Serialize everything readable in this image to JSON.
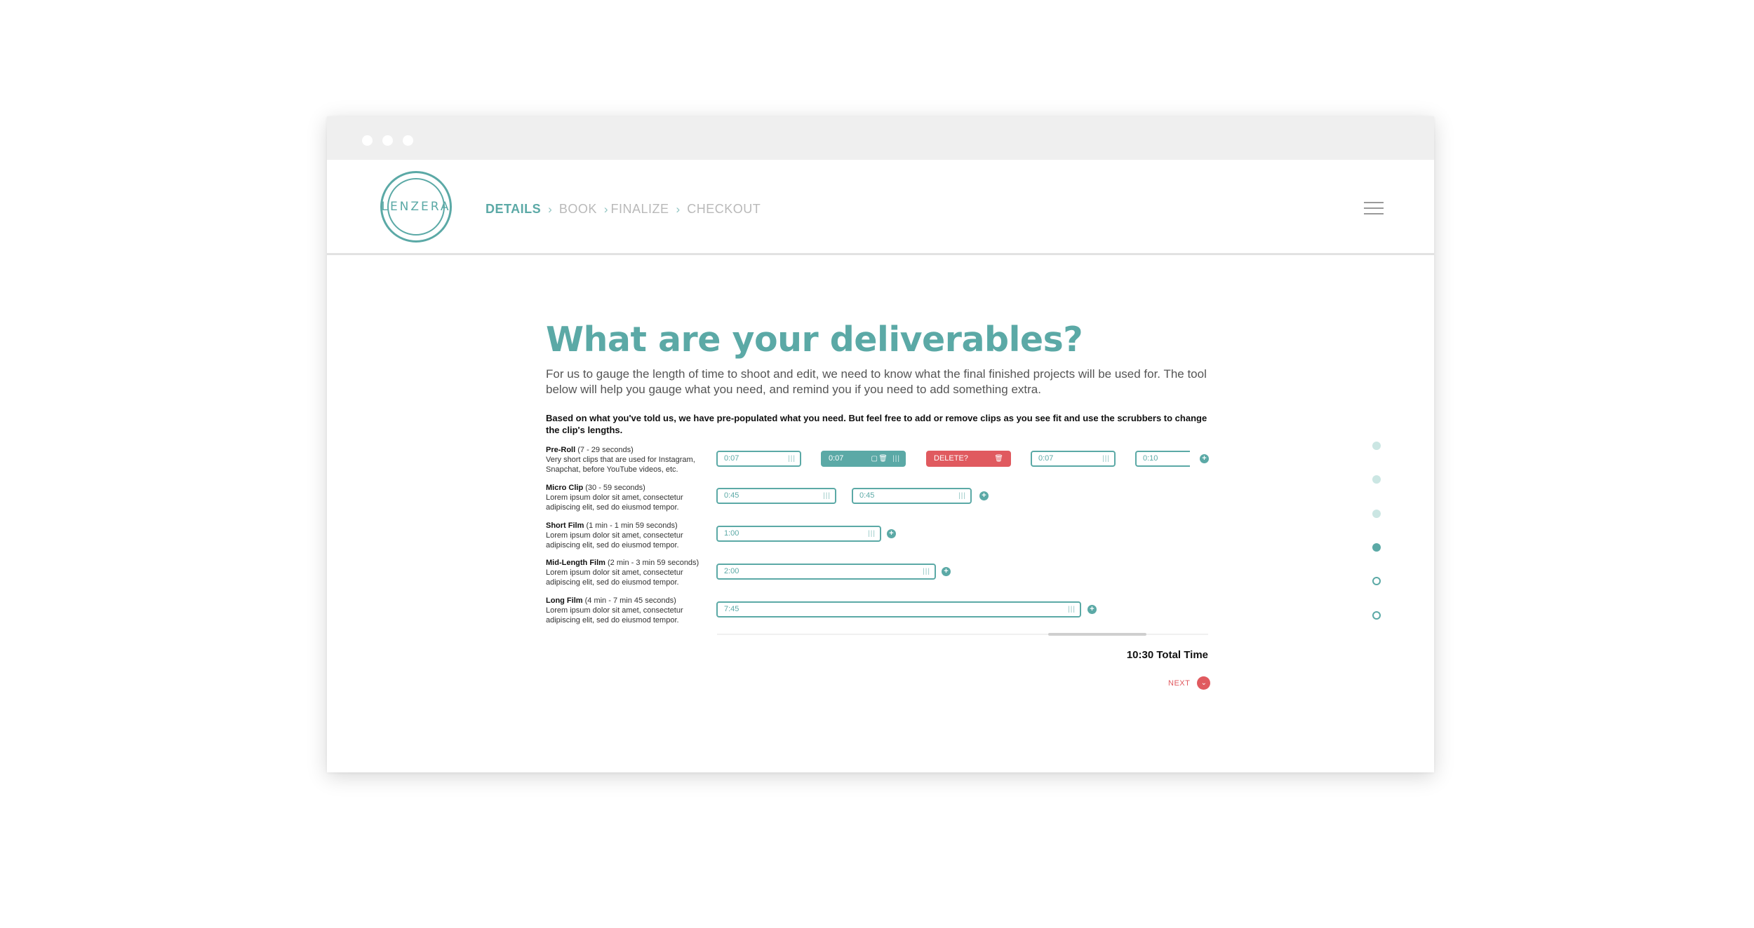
{
  "logo": {
    "text": "LENZERA"
  },
  "steps": [
    {
      "label": "DETAILS"
    },
    {
      "label": "BOOK"
    },
    {
      "label": "FINALIZE"
    },
    {
      "label": "CHECKOUT"
    }
  ],
  "page": {
    "title": "What are your deliverables?",
    "intro": "For us to gauge the length of time to shoot and edit, we need to know what the final finished projects will be used for. The tool below will help you gauge what you need, and remind you if you need to add something extra.",
    "instruction": "Based on what you've told us, we have pre-populated what you need. But feel free to add or remove clips as you see fit and use the scrubbers to change the clip's lengths."
  },
  "rows": [
    {
      "name": "Pre-Roll",
      "range": "(7 - 29 seconds)",
      "desc": "Very short clips that are used for Instagram, Snapchat, before YouTube videos, etc.",
      "clips": [
        "0:07",
        "0:07",
        "DELETE?",
        "0:07",
        "0:10"
      ]
    },
    {
      "name": "Micro Clip",
      "range": "(30 - 59 seconds)",
      "desc": "Lorem ipsum dolor sit amet, consectetur adipiscing elit, sed do eiusmod tempor.",
      "clips": [
        "0:45",
        "0:45"
      ]
    },
    {
      "name": "Short Film",
      "range": "(1 min - 1 min 59 seconds)",
      "desc": "Lorem ipsum dolor sit amet, consectetur adipiscing elit, sed do eiusmod tempor.",
      "clips": [
        "1:00"
      ]
    },
    {
      "name": "Mid-Length Film",
      "range": "(2 min - 3 min 59 seconds)",
      "desc": "Lorem ipsum dolor sit amet, consectetur adipiscing elit, sed do eiusmod tempor.",
      "clips": [
        "2:00"
      ]
    },
    {
      "name": "Long Film",
      "range": "(4 min - 7 min 45 seconds)",
      "desc": "Lorem ipsum dolor sit amet, consectetur adipiscing elit, sed do eiusmod tempor.",
      "clips": [
        "7:45"
      ]
    }
  ],
  "total": "10:30 Total Time",
  "next": "NEXT",
  "icons": {
    "grip": "|||",
    "plus": "+",
    "trash": "🗑",
    "copy": "▢",
    "chevron": "›",
    "next_arrow": "⌄"
  },
  "progress": {
    "total_steps": 6,
    "current_step": 4
  },
  "colors": {
    "accent": "#5ba9a6",
    "danger": "#e05a5f",
    "muted": "#b9b9b9"
  }
}
